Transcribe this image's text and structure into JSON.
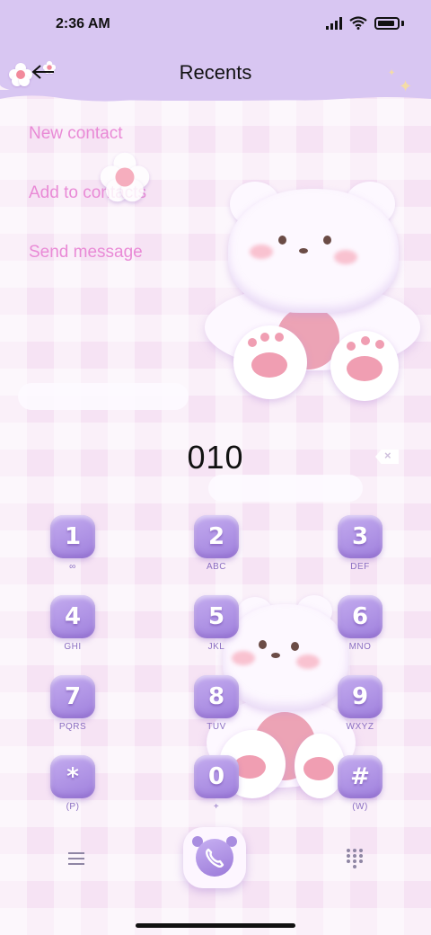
{
  "status_bar": {
    "time": "2:36 AM"
  },
  "header": {
    "title": "Recents",
    "back_icon": "arrow-left-icon"
  },
  "menu": {
    "new_contact": "New contact",
    "add_to_contacts": "Add to contacts",
    "send_message": "Send message"
  },
  "dialer": {
    "number": "010"
  },
  "keypad": [
    {
      "digit": "1",
      "letters": "∞"
    },
    {
      "digit": "2",
      "letters": "ABC"
    },
    {
      "digit": "3",
      "letters": "DEF"
    },
    {
      "digit": "4",
      "letters": "GHI"
    },
    {
      "digit": "5",
      "letters": "JKL"
    },
    {
      "digit": "6",
      "letters": "MNO"
    },
    {
      "digit": "7",
      "letters": "PQRS"
    },
    {
      "digit": "8",
      "letters": "TUV"
    },
    {
      "digit": "9",
      "letters": "WXYZ"
    },
    {
      "digit": "*",
      "letters": "(P)"
    },
    {
      "digit": "0",
      "letters": "+"
    },
    {
      "digit": "#",
      "letters": "(W)"
    }
  ],
  "colors": {
    "header_bg": "#d8c6f2",
    "menu_text": "#e98ad6",
    "key_purple": "#a98de0",
    "background": "#f6e3f4"
  }
}
